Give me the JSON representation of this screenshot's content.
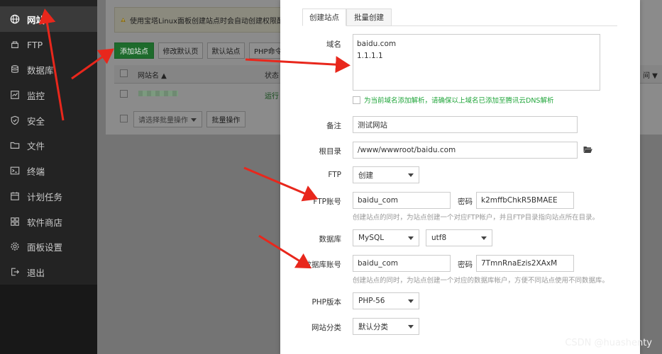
{
  "sidebar": {
    "items": [
      {
        "label": "网站",
        "icon": "globe-icon",
        "active": true
      },
      {
        "label": "FTP",
        "icon": "ftp-icon"
      },
      {
        "label": "数据库",
        "icon": "database-icon"
      },
      {
        "label": "监控",
        "icon": "monitor-icon"
      },
      {
        "label": "安全",
        "icon": "shield-icon"
      },
      {
        "label": "文件",
        "icon": "folder-icon"
      },
      {
        "label": "终端",
        "icon": "terminal-icon"
      },
      {
        "label": "计划任务",
        "icon": "calendar-icon"
      },
      {
        "label": "软件商店",
        "icon": "grid-icon"
      },
      {
        "label": "面板设置",
        "icon": "gear-icon"
      },
      {
        "label": "退出",
        "icon": "logout-icon"
      }
    ]
  },
  "background": {
    "warning": "使用宝塔Linux面板创建站点时会自动创建权限配",
    "buttons": {
      "add_site": "添加站点",
      "edit_default_page": "修改默认页",
      "default_site": "默认站点",
      "php_cmd": "PHP命令"
    },
    "table": {
      "col_name": "网站名 ▲",
      "col_status": "状态",
      "col_time": "间 ▼",
      "row_status": "运行"
    },
    "batch": {
      "select_placeholder": "请选择批量操作",
      "button": "批量操作"
    }
  },
  "modal": {
    "tabs": [
      "创建站点",
      "批量创建"
    ],
    "labels": {
      "domain": "域名",
      "note": "备注",
      "root": "根目录",
      "ftp": "FTP",
      "ftp_account": "FTP账号",
      "database": "数据库",
      "db_account": "数据库账号",
      "php_version": "PHP版本",
      "site_category": "网站分类",
      "password": "密码"
    },
    "domain_lines": [
      "baidu.com",
      "1.1.1.1"
    ],
    "dns_checkbox": "为当前域名添加解析，请确保以上域名已添加至腾讯云DNS解析",
    "note_value": "测试网站",
    "root_value": "/www/wwwroot/baidu.com",
    "ftp_select": "创建",
    "ftp_user": "baidu_com",
    "ftp_pass": "k2mffbChkR5BMAEE",
    "ftp_hint": "创建站点的同时，为站点创建一个对应FTP帐户，并且FTP目录指向站点所在目录。",
    "db_type": "MySQL",
    "db_charset": "utf8",
    "db_user": "baidu_com",
    "db_pass": "7TmnRnaEzis2XAxM",
    "db_hint": "创建站点的同时，为站点创建一个对应的数据库帐户，方便不同站点使用不同数据库。",
    "php_version": "PHP-56",
    "site_category": "默认分类"
  },
  "watermark": "CSDN @huashenty",
  "colors": {
    "arrow": "#e8271c",
    "accent_green": "#20a53a",
    "sidebar_bg": "#232323"
  }
}
